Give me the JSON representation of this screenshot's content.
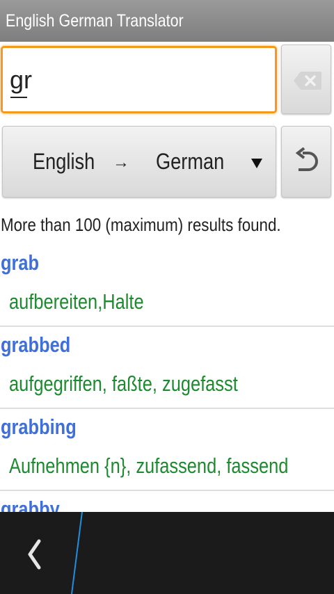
{
  "app": {
    "title": "English German Translator"
  },
  "search": {
    "value": "gr",
    "clear_icon": "backspace-clear-icon"
  },
  "language": {
    "source": "English",
    "arrow": "→",
    "target": "German",
    "dropdown_icon": "dropdown-triangle-icon",
    "swap_icon": "undo-swap-icon"
  },
  "status": {
    "text": "More than 100 (maximum) results found."
  },
  "results": [
    {
      "term": "grab",
      "translation": "aufbereiten,Halte"
    },
    {
      "term": "grabbed",
      "translation": "aufgegriffen, faßte, zugefasst"
    },
    {
      "term": "grabbing",
      "translation": "Aufnehmen {n}, zufassend, fassend"
    },
    {
      "term": "grabby",
      "translation": ""
    }
  ],
  "bottombar": {
    "back_icon": "chevron-left-icon"
  },
  "colors": {
    "term": "#3f6fd8",
    "translation": "#1d8a2f",
    "focus": "#f39a1e",
    "titlebar": "#8a8a8a",
    "accent_line": "#1f8fe0"
  }
}
